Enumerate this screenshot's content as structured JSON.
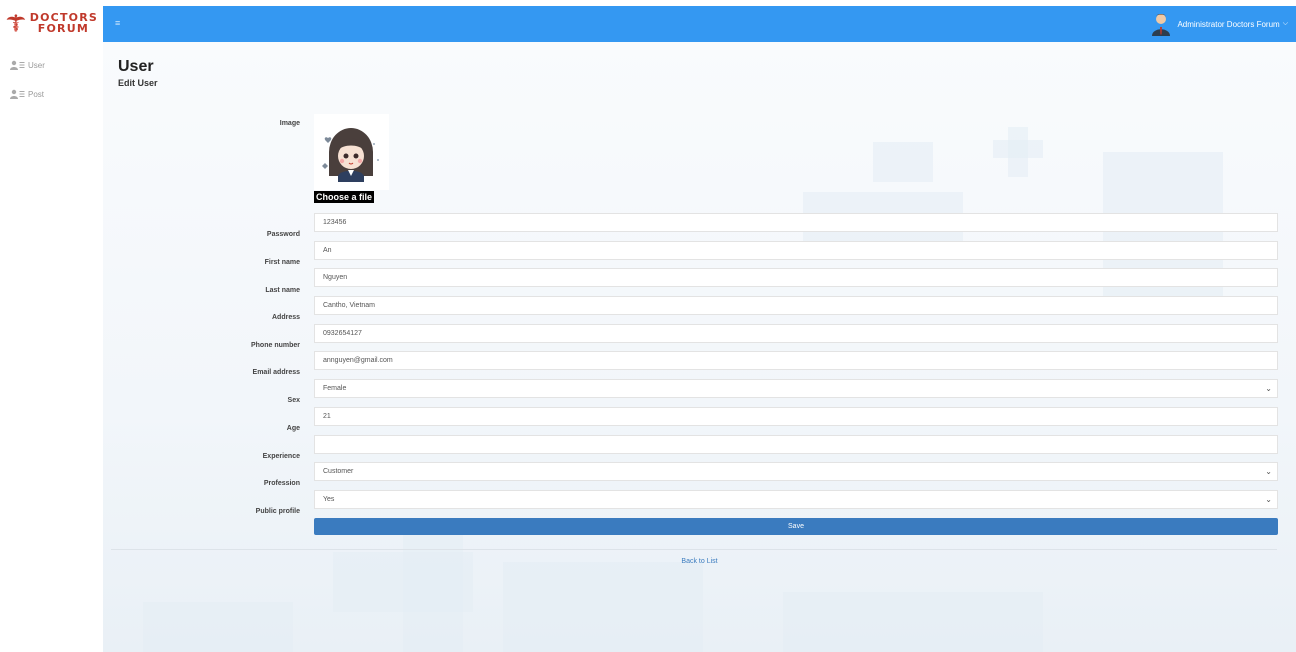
{
  "brand": {
    "line1": "DOCTORS",
    "line2": "FORUM",
    "color": "#c0392b"
  },
  "sidebar": {
    "items": [
      {
        "label": "User",
        "icon": "users-icon"
      },
      {
        "label": "Post",
        "icon": "users-icon"
      }
    ]
  },
  "topbar": {
    "menu_icon": "≡",
    "user_name": "Administrator Doctors Forum",
    "chevron": "⌵",
    "color": "#3498f2"
  },
  "page": {
    "title": "User",
    "subtitle": "Edit User"
  },
  "form": {
    "image_label": "Image",
    "choose_file": "Choose a file",
    "password": {
      "label": "Password",
      "value": "123456"
    },
    "first_name": {
      "label": "First name",
      "value": "An"
    },
    "last_name": {
      "label": "Last name",
      "value": "Nguyen"
    },
    "address": {
      "label": "Address",
      "value": "Cantho, Vietnam"
    },
    "phone": {
      "label": "Phone number",
      "value": "0932654127"
    },
    "email": {
      "label": "Email address",
      "value": "annguyen@gmail.com"
    },
    "sex": {
      "label": "Sex",
      "value": "Female"
    },
    "age": {
      "label": "Age",
      "value": "21"
    },
    "experience": {
      "label": "Experience",
      "value": ""
    },
    "profession": {
      "label": "Profession",
      "value": "Customer"
    },
    "public_profile": {
      "label": "Public profile",
      "value": "Yes"
    },
    "save_label": "Save",
    "save_color": "#3a7bbf"
  },
  "back_link": "Back to List"
}
